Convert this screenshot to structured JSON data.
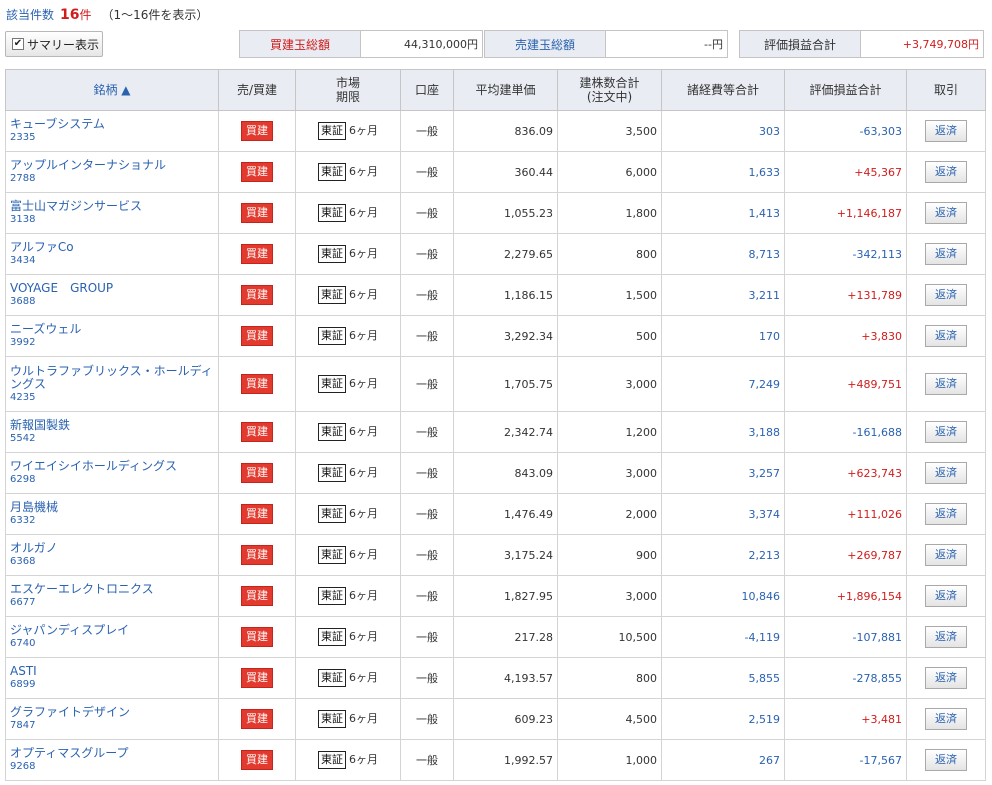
{
  "header": {
    "count_label": "該当件数",
    "count_value": "16",
    "count_unit": "件",
    "range_text": "（1〜16件を表示）"
  },
  "summary_button": {
    "label": "サマリー表示"
  },
  "summary": {
    "buy": {
      "label": "買建玉総額",
      "value": "44,310,000円"
    },
    "sell": {
      "label": "売建玉総額",
      "value": "--円"
    },
    "pl": {
      "label": "評価損益合計",
      "value": "+3,749,708円"
    }
  },
  "columns": {
    "name": "銘柄",
    "sort_mark": "▲",
    "side": "売/買建",
    "market": "市場",
    "market_sub": "期限",
    "account": "口座",
    "avg_price": "平均建単価",
    "qty": "建株数合計",
    "qty_sub": "(注文中)",
    "fees": "諸経費等合計",
    "pl": "評価損益合計",
    "trade": "取引"
  },
  "rows": [
    {
      "name": "キューブシステム",
      "code": "2335",
      "side": "買建",
      "market": "東証",
      "period": "6ヶ月",
      "account": "一般",
      "avg_price": "836.09",
      "qty": "3,500",
      "fees": "303",
      "pl": "-63,303",
      "trade": "返済"
    },
    {
      "name": "アップルインターナショナル",
      "code": "2788",
      "side": "買建",
      "market": "東証",
      "period": "6ヶ月",
      "account": "一般",
      "avg_price": "360.44",
      "qty": "6,000",
      "fees": "1,633",
      "pl": "+45,367",
      "trade": "返済"
    },
    {
      "name": "富士山マガジンサービス",
      "code": "3138",
      "side": "買建",
      "market": "東証",
      "period": "6ヶ月",
      "account": "一般",
      "avg_price": "1,055.23",
      "qty": "1,800",
      "fees": "1,413",
      "pl": "+1,146,187",
      "trade": "返済"
    },
    {
      "name": "アルファCo",
      "code": "3434",
      "side": "買建",
      "market": "東証",
      "period": "6ヶ月",
      "account": "一般",
      "avg_price": "2,279.65",
      "qty": "800",
      "fees": "8,713",
      "pl": "-342,113",
      "trade": "返済"
    },
    {
      "name": "VOYAGE　GROUP",
      "code": "3688",
      "side": "買建",
      "market": "東証",
      "period": "6ヶ月",
      "account": "一般",
      "avg_price": "1,186.15",
      "qty": "1,500",
      "fees": "3,211",
      "pl": "+131,789",
      "trade": "返済"
    },
    {
      "name": "ニーズウェル",
      "code": "3992",
      "side": "買建",
      "market": "東証",
      "period": "6ヶ月",
      "account": "一般",
      "avg_price": "3,292.34",
      "qty": "500",
      "fees": "170",
      "pl": "+3,830",
      "trade": "返済"
    },
    {
      "name": "ウルトラファブリックス・ホールディングス",
      "code": "4235",
      "side": "買建",
      "market": "東証",
      "period": "6ヶ月",
      "account": "一般",
      "avg_price": "1,705.75",
      "qty": "3,000",
      "fees": "7,249",
      "pl": "+489,751",
      "trade": "返済"
    },
    {
      "name": "新報国製鉄",
      "code": "5542",
      "side": "買建",
      "market": "東証",
      "period": "6ヶ月",
      "account": "一般",
      "avg_price": "2,342.74",
      "qty": "1,200",
      "fees": "3,188",
      "pl": "-161,688",
      "trade": "返済"
    },
    {
      "name": "ワイエイシイホールディングス",
      "code": "6298",
      "side": "買建",
      "market": "東証",
      "period": "6ヶ月",
      "account": "一般",
      "avg_price": "843.09",
      "qty": "3,000",
      "fees": "3,257",
      "pl": "+623,743",
      "trade": "返済"
    },
    {
      "name": "月島機械",
      "code": "6332",
      "side": "買建",
      "market": "東証",
      "period": "6ヶ月",
      "account": "一般",
      "avg_price": "1,476.49",
      "qty": "2,000",
      "fees": "3,374",
      "pl": "+111,026",
      "trade": "返済"
    },
    {
      "name": "オルガノ",
      "code": "6368",
      "side": "買建",
      "market": "東証",
      "period": "6ヶ月",
      "account": "一般",
      "avg_price": "3,175.24",
      "qty": "900",
      "fees": "2,213",
      "pl": "+269,787",
      "trade": "返済"
    },
    {
      "name": "エスケーエレクトロニクス",
      "code": "6677",
      "side": "買建",
      "market": "東証",
      "period": "6ヶ月",
      "account": "一般",
      "avg_price": "1,827.95",
      "qty": "3,000",
      "fees": "10,846",
      "pl": "+1,896,154",
      "trade": "返済"
    },
    {
      "name": "ジャパンディスプレイ",
      "code": "6740",
      "side": "買建",
      "market": "東証",
      "period": "6ヶ月",
      "account": "一般",
      "avg_price": "217.28",
      "qty": "10,500",
      "fees": "-4,119",
      "pl": "-107,881",
      "trade": "返済"
    },
    {
      "name": "ASTI",
      "code": "6899",
      "side": "買建",
      "market": "東証",
      "period": "6ヶ月",
      "account": "一般",
      "avg_price": "4,193.57",
      "qty": "800",
      "fees": "5,855",
      "pl": "-278,855",
      "trade": "返済"
    },
    {
      "name": "グラファイトデザイン",
      "code": "7847",
      "side": "買建",
      "market": "東証",
      "period": "6ヶ月",
      "account": "一般",
      "avg_price": "609.23",
      "qty": "4,500",
      "fees": "2,519",
      "pl": "+3,481",
      "trade": "返済"
    },
    {
      "name": "オプティマスグループ",
      "code": "9268",
      "side": "買建",
      "market": "東証",
      "period": "6ヶ月",
      "account": "一般",
      "avg_price": "1,992.57",
      "qty": "1,000",
      "fees": "267",
      "pl": "-17,567",
      "trade": "返済"
    }
  ]
}
